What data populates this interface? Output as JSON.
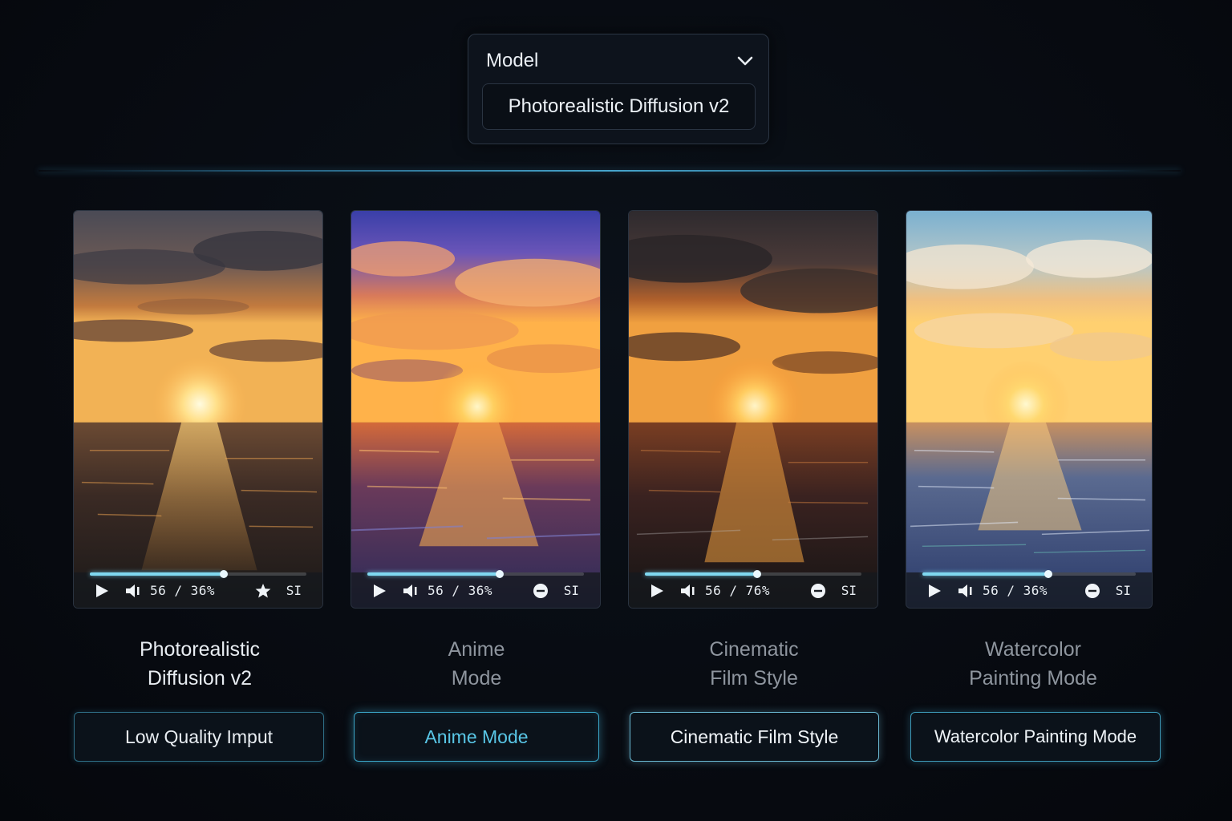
{
  "model": {
    "label": "Model",
    "selected": "Photorealistic Diffusion v2"
  },
  "cards": [
    {
      "caption_line1": "Photorealistic",
      "caption_line2": "Diffusion v2",
      "time": "56 / 36%",
      "tag": "SI",
      "secondary_icon": "star-icon",
      "progress": 0.62,
      "button": "Low Quality Imput"
    },
    {
      "caption_line1": "Anime",
      "caption_line2": "Mode",
      "time": "56 / 36%",
      "tag": "SI",
      "secondary_icon": "minus-circle-icon",
      "progress": 0.61,
      "button": "Anime Mode"
    },
    {
      "caption_line1": "Cinematic",
      "caption_line2": "Film Style",
      "time": "56 / 76%",
      "tag": "SI",
      "secondary_icon": "minus-circle-icon",
      "progress": 0.52,
      "button": "Cinematic Film Style"
    },
    {
      "caption_line1": "Watercolor",
      "caption_line2": "Painting Mode",
      "time": "56 / 36%",
      "tag": "SI",
      "secondary_icon": "minus-circle-icon",
      "progress": 0.59,
      "button": "Watercolor Painting Mode"
    }
  ],
  "colors": {
    "accent": "#59c6e6",
    "background": "#070b12",
    "progress": "#7fd8f0"
  }
}
